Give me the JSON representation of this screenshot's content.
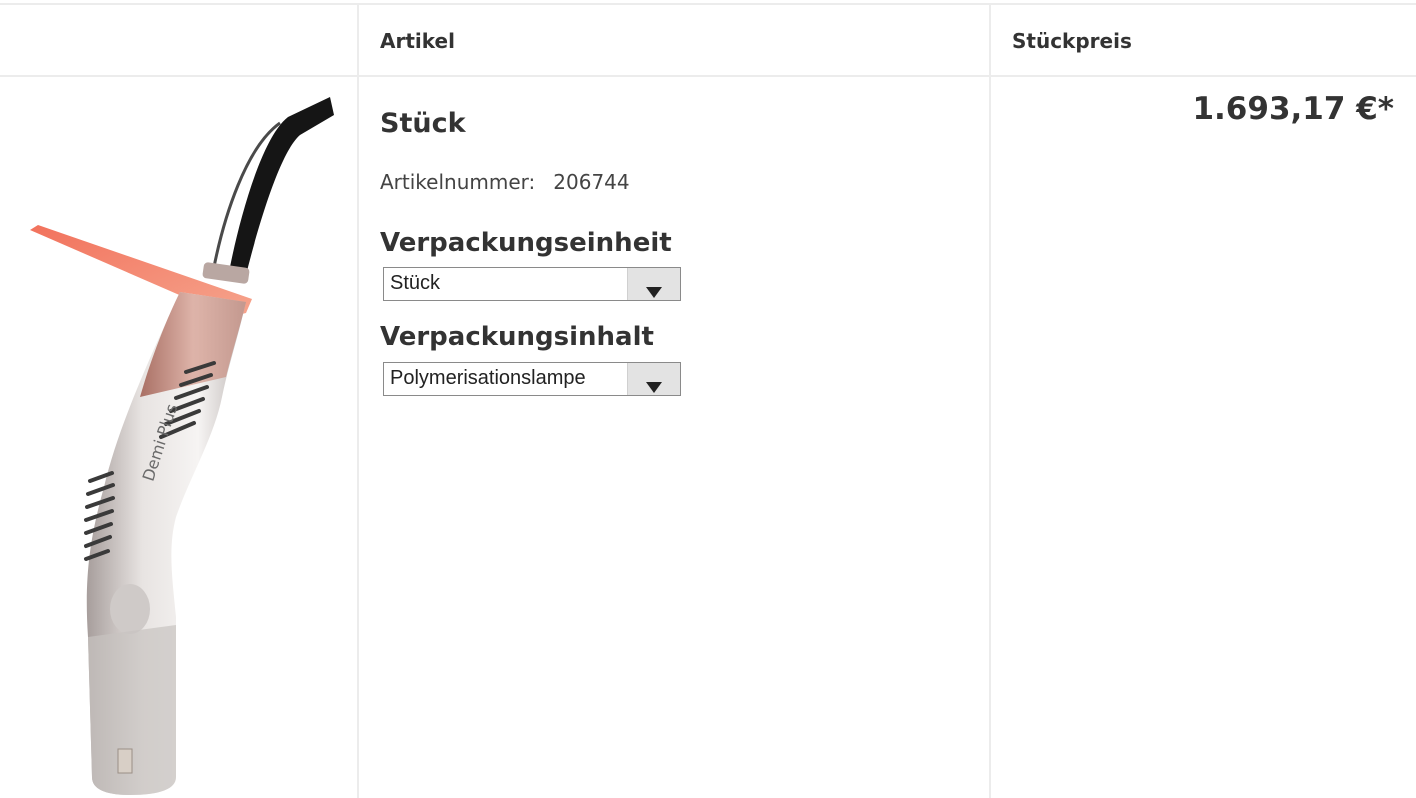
{
  "table": {
    "headers": [
      "Artikel",
      "Stückpreis"
    ]
  },
  "product": {
    "image_alt": "Polymerisationslampe",
    "title": "Stück",
    "article_number_label": "Artikelnummer:",
    "article_number": "206744",
    "packaging_unit_label": "Verpackungseinheit",
    "packaging_unit_value": "Stück",
    "packaging_content_label": "Verpackungsinhalt",
    "packaging_content_value": "Polymerisationslampe",
    "price": "1.693,17 €*"
  },
  "colors": {
    "text": "#333333",
    "border": "#ececec",
    "arrow_bg": "#e3e3e3"
  }
}
